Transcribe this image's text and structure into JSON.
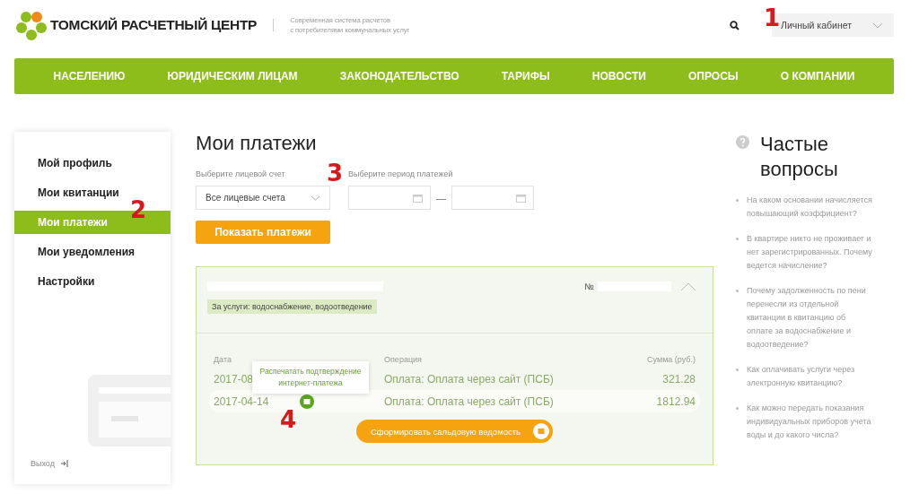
{
  "header": {
    "brand": "ТОМСКИЙ РАСЧЕТНЫЙ ЦЕНТР",
    "tagline_lines": [
      "Современная система расчетов",
      "с потребителями коммунальных услуг"
    ],
    "account_menu": "Личный кабинет"
  },
  "nav": [
    "НАСЕЛЕНИЮ",
    "ЮРИДИЧЕСКИМ ЛИЦАМ",
    "ЗАКОНОДАТЕЛЬСТВО",
    "ТАРИФЫ",
    "НОВОСТИ",
    "ОПРОСЫ",
    "О КОМПАНИИ"
  ],
  "sidebar": {
    "items": [
      {
        "label": "Мой профиль",
        "selected": false
      },
      {
        "label": "Мои квитанции",
        "selected": false
      },
      {
        "label": "Мои платежи",
        "selected": true
      },
      {
        "label": "Мои уведомления",
        "selected": false
      },
      {
        "label": "Настройки",
        "selected": false
      }
    ],
    "logout": "Выход"
  },
  "main": {
    "title": "Мои платежи",
    "account_label": "Выберите лицевой счет",
    "account_value": "Все лицевые счета",
    "period_label": "Выберите период платежей",
    "period_separator": "—",
    "show_button": "Показать платежи",
    "card": {
      "number_label": "№",
      "expanded": true,
      "services": "За услуги: водоснабжение, водоотведение",
      "columns": [
        "Дата",
        "Операция",
        "Сумма (руб.)"
      ],
      "rows": [
        {
          "date": "2017-08",
          "operation": "Оплата: Оплата через сайт (ПСБ)",
          "amount": "321.28",
          "highlighted": false
        },
        {
          "date": "2017-04-14",
          "operation": "Оплата: Оплата через сайт (ПСБ)",
          "amount": "1812.94",
          "highlighted": true
        }
      ],
      "tooltip": "Распечатать подтверждение интернет-платежа",
      "statement_button": "Сформировать сальдовую ведомость"
    }
  },
  "faq": {
    "title": "Частые вопросы",
    "items": [
      "На каком основании начисляется повышающий коэффициент?",
      "В квартире никто не проживает и нет зарегистрированных. Почему ведется начисление?",
      "Почему задолженность по пени перенесли из отдельной квитанции в квитанцию об оплате за водоснабжение и водоотведение?",
      "Как оплачивать услуги через электронную квитанцию?",
      "Как можно передать показания индивидуальных приборов учета воды и до какого числа?"
    ]
  },
  "annotations": [
    "1",
    "2",
    "3",
    "4"
  ]
}
